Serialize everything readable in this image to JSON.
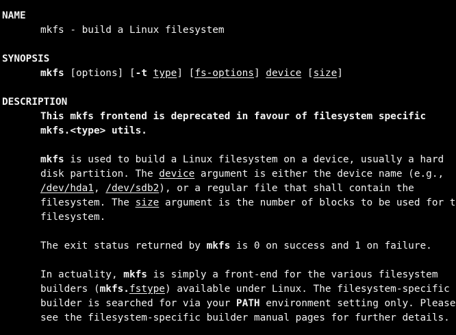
{
  "name": {
    "heading": "NAME",
    "text": "mkfs - build a Linux filesystem"
  },
  "synopsis": {
    "heading": "SYNOPSIS",
    "cmd": "mkfs",
    "options": "[options]",
    "t_open": "[-t",
    "t_flag_space": " ",
    "type": "type",
    "close_open": "] [",
    "fs_options": "fs-options",
    "close_sp": "] ",
    "device": "device",
    "open_br": " [",
    "size": "size",
    "close_br": "]"
  },
  "description": {
    "heading": "DESCRIPTION",
    "deprecated_l1": "This mkfs frontend is deprecated in favour of filesystem specific",
    "deprecated_l2": "mkfs.<type> utils.",
    "p1": {
      "l1_cmd": "mkfs",
      "l1_rest": " is used to build a Linux filesystem on a device, usually a hard",
      "l2_a": "disk partition. The ",
      "l2_device": "device",
      "l2_b": " argument is either the device name (e.g.,",
      "l3_dev1": "/dev/hda1",
      "l3_comma": ", ",
      "l3_dev2": "/dev/sdb2",
      "l3_rest": "), or a regular file that shall contain the",
      "l4_a": "filesystem. The ",
      "l4_size": "size",
      "l4_b": " argument is the number of blocks to be used for the",
      "l5": "filesystem."
    },
    "p2": {
      "a": "The exit status returned by ",
      "cmd": "mkfs",
      "b": " is 0 on success and 1 on failure."
    },
    "p3": {
      "l1_a": "In actuality, ",
      "l1_cmd": "mkfs",
      "l1_b": " is simply a front-end for the various filesystem",
      "l2_a": "builders (",
      "l2_mkfs": "mkfs.",
      "l2_fstype": "fstype",
      "l2_b": ") available under Linux. The filesystem-specific",
      "l3_a": "builder is searched for via your ",
      "l3_path": "PATH",
      "l3_b": " environment setting only. Please",
      "l4": "see the filesystem-specific builder manual pages for further details."
    }
  }
}
